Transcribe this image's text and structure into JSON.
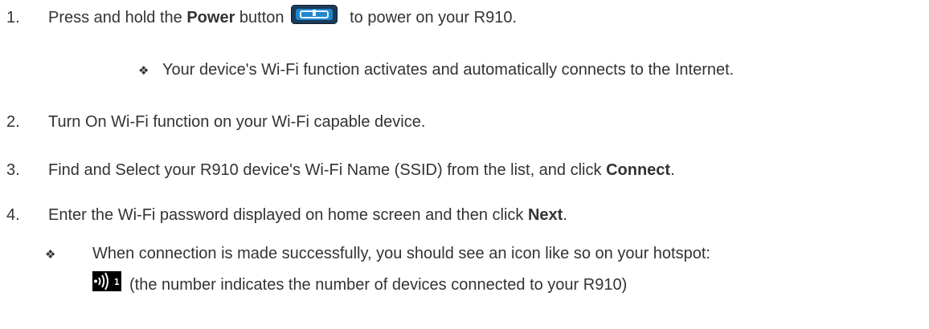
{
  "steps": [
    {
      "number": "1.",
      "pre": "Press and hold the ",
      "bold": "Power",
      "mid": " button",
      "post": " to power on your R910."
    },
    {
      "number": "2.",
      "text": "Turn On Wi-Fi function on your Wi-Fi capable device."
    },
    {
      "number": "3.",
      "pre": "Find and Select your R910 device's Wi-Fi Name (SSID) from the list, and click ",
      "bold": "Connect",
      "post": "."
    },
    {
      "number": "4.",
      "pre": "Enter the Wi-Fi password displayed on home screen and then click ",
      "bold": "Next",
      "post": "."
    }
  ],
  "notes": {
    "bullet": "❖",
    "wifi_activates": "Your device's Wi-Fi function activates and automatically connects to the Internet.",
    "connection_success": "When connection is made successfully, you should see an icon like so on your hotspot:",
    "icon_caption": "(the number indicates the number of devices connected to your R910)",
    "icon_count": "1"
  },
  "icons": {
    "power": "power-button-icon",
    "wifi": "wifi-connected-icon"
  }
}
